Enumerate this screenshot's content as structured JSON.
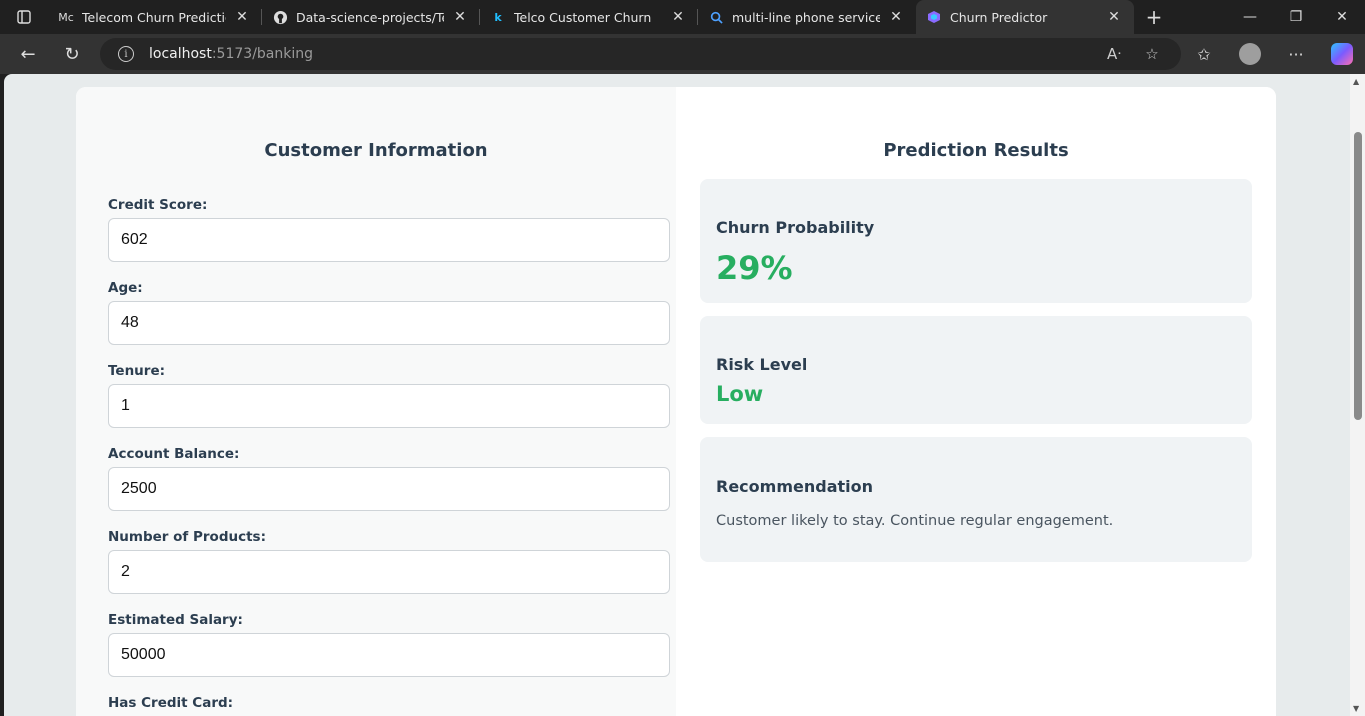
{
  "browser": {
    "tabs": [
      {
        "favicon": "Mc",
        "title": "Telecom Churn Prediction. Mo",
        "active": false
      },
      {
        "favicon": "github-icon",
        "title": "Data-science-projects/Telco_c",
        "active": false
      },
      {
        "favicon": "k",
        "title": "Telco Customer Churn",
        "active": false
      },
      {
        "favicon": "search-icon",
        "title": "multi-line phone service mear",
        "active": false
      },
      {
        "favicon": "app-icon",
        "title": "Churn Predictor",
        "active": true
      }
    ],
    "url_host": "localhost",
    "url_rest": ":5173/banking"
  },
  "form": {
    "title": "Customer Information",
    "fields": [
      {
        "label": "Credit Score:",
        "value": "602"
      },
      {
        "label": "Age:",
        "value": "48"
      },
      {
        "label": "Tenure:",
        "value": "1"
      },
      {
        "label": "Account Balance:",
        "value": "2500"
      },
      {
        "label": "Number of Products:",
        "value": "2"
      },
      {
        "label": "Estimated Salary:",
        "value": "50000"
      }
    ],
    "next_label": "Has Credit Card:"
  },
  "results": {
    "title": "Prediction Results",
    "churn_probability_label": "Churn Probability",
    "churn_probability_value": "29%",
    "risk_level_label": "Risk Level",
    "risk_level_value": "Low",
    "recommendation_label": "Recommendation",
    "recommendation_text": "Customer likely to stay. Continue regular engagement."
  },
  "colors": {
    "accent_green": "#27ae60",
    "heading": "#2c3e50"
  }
}
